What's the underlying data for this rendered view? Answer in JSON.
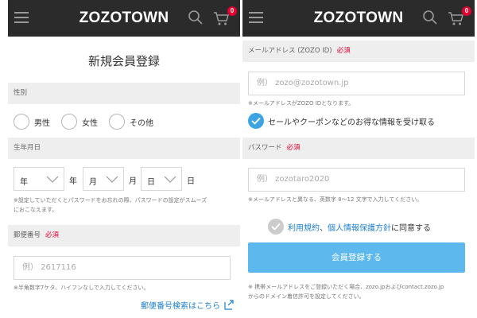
{
  "brand": {
    "logo": "ZOZOTOWN",
    "cart_count": "0"
  },
  "colors": {
    "appbar": "#2b2b2b",
    "required": "#e5002d",
    "link": "#1e7fd0",
    "button": "#5cb8ed",
    "check_active": "#3ea3e3",
    "check_inactive": "#cccccc",
    "section_bg": "#eeeeee"
  },
  "left": {
    "title": "新規会員登録",
    "gender": {
      "label": "性別",
      "options": [
        "男性",
        "女性",
        "その他"
      ]
    },
    "birth": {
      "label": "生年月日",
      "year": {
        "value": "年",
        "unit": "年"
      },
      "month": {
        "value": "月",
        "unit": "月"
      },
      "day": {
        "value": "日",
        "unit": "日"
      },
      "note_line1": "※設定していただくとパスワードをお忘れの際、パスワードの設定がスムーズ",
      "note_line2": "におこなえます。"
    },
    "postal": {
      "label": "郵便番号",
      "required": "必須",
      "placeholder": "例） 2617116",
      "note": "※半角数字7ケタ、ハイフンなしで入力してください。",
      "search_link": "郵便番号検索はこちら"
    }
  },
  "right": {
    "email": {
      "label": "メールアドレス (ZOZO ID)",
      "required": "必須",
      "placeholder": "例） zozo@zozotown.jp",
      "note": "※メールアドレスがZOZO IDとなります。"
    },
    "newsletter": {
      "label": "セールやクーポンなどのお得な情報を受け取る",
      "checked": true
    },
    "password": {
      "label": "パスワード",
      "required": "必須",
      "placeholder": "例） zozotaro2020",
      "note": "※メールアドレスと異なる、英数字 8～12 文字で入力してください。"
    },
    "agree": {
      "terms": "利用規約",
      "separator": "、",
      "privacy": "個人情報保護方針",
      "suffix": "に同意する",
      "checked": false
    },
    "submit_label": "会員登録する",
    "footer_line1": "※ 携帯メールアドレスをご登録いただく場合、zozo.jpおよびcontact.zozo.jp",
    "footer_line2": "からのドメイン着信許可を設定してください。"
  }
}
